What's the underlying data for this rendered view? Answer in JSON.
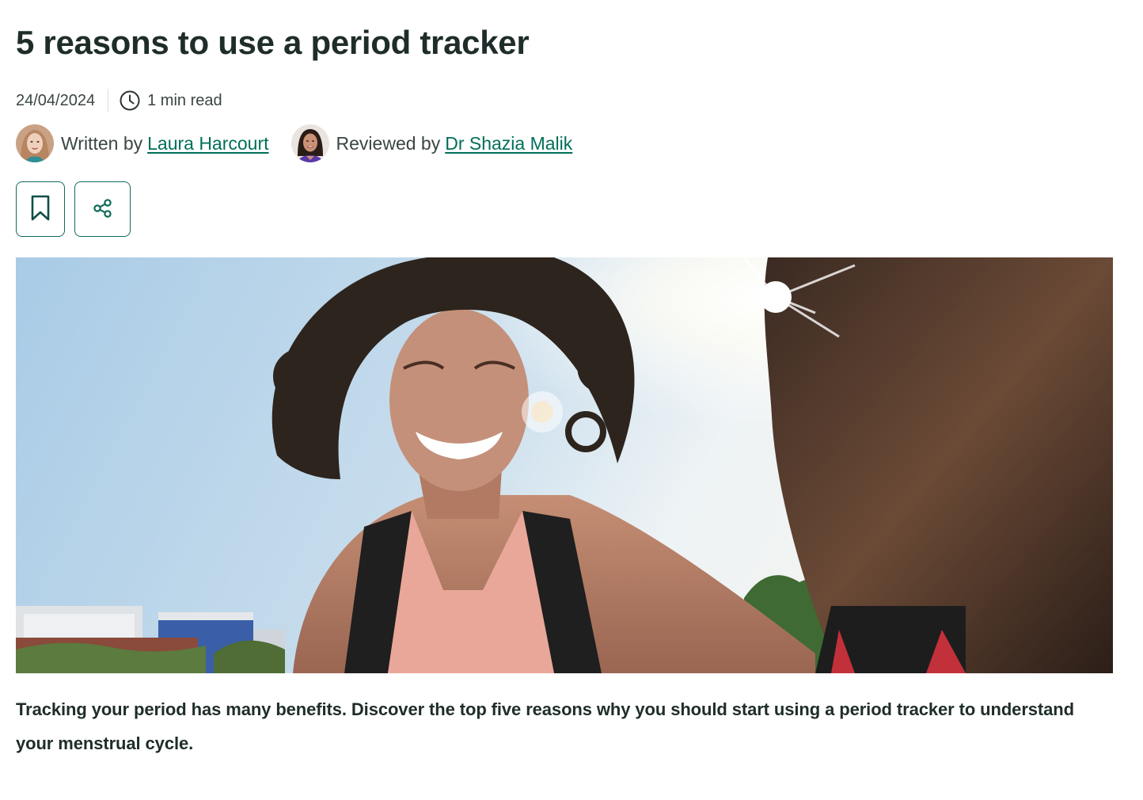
{
  "article": {
    "title": "5 reasons to use a period tracker",
    "date": "24/04/2024",
    "read_time": "1 min read",
    "author": {
      "label": "Written by",
      "name": "Laura Harcourt"
    },
    "reviewer": {
      "label": "Reviewed by",
      "name": "Dr Shazia Malik"
    },
    "intro": "Tracking your period has many benefits. Discover the top five reasons why you should start using a period tracker to understand your menstrual cycle."
  },
  "icons": {
    "clock": "clock-icon",
    "bookmark": "bookmark-icon",
    "share": "share-icon"
  },
  "colors": {
    "text": "#1f2d2a",
    "link": "#006f58",
    "button_border": "#0f6b5b"
  }
}
